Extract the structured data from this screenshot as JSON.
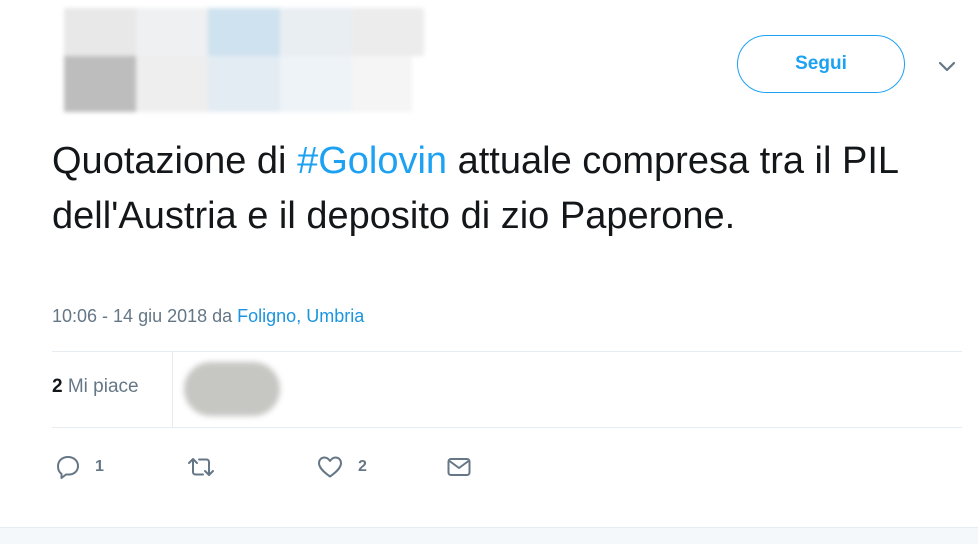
{
  "header": {
    "avatar_icon": "blurred-avatar",
    "follow_label": "Segui",
    "menu_icon": "chevron-down-icon"
  },
  "tweet": {
    "text_before": "Quotazione di ",
    "hashtag": "#Golovin",
    "text_after": " attuale compresa tra il PIL dell'Austria e il deposito di zio Paperone.",
    "time_date": "10:06 - 14 giu 2018 da ",
    "location": "Foligno, Umbria"
  },
  "stats": {
    "likes_count": "2",
    "likes_label": "Mi piace"
  },
  "actions": {
    "reply": {
      "icon": "reply-icon",
      "count": "1"
    },
    "retweet": {
      "icon": "retweet-icon",
      "count": ""
    },
    "like": {
      "icon": "heart-icon",
      "count": "2"
    },
    "message": {
      "icon": "mail-icon",
      "count": ""
    }
  },
  "colors": {
    "accent": "#1da1f2",
    "text": "#14171a",
    "muted": "#657786",
    "border": "#e6ecf0"
  }
}
